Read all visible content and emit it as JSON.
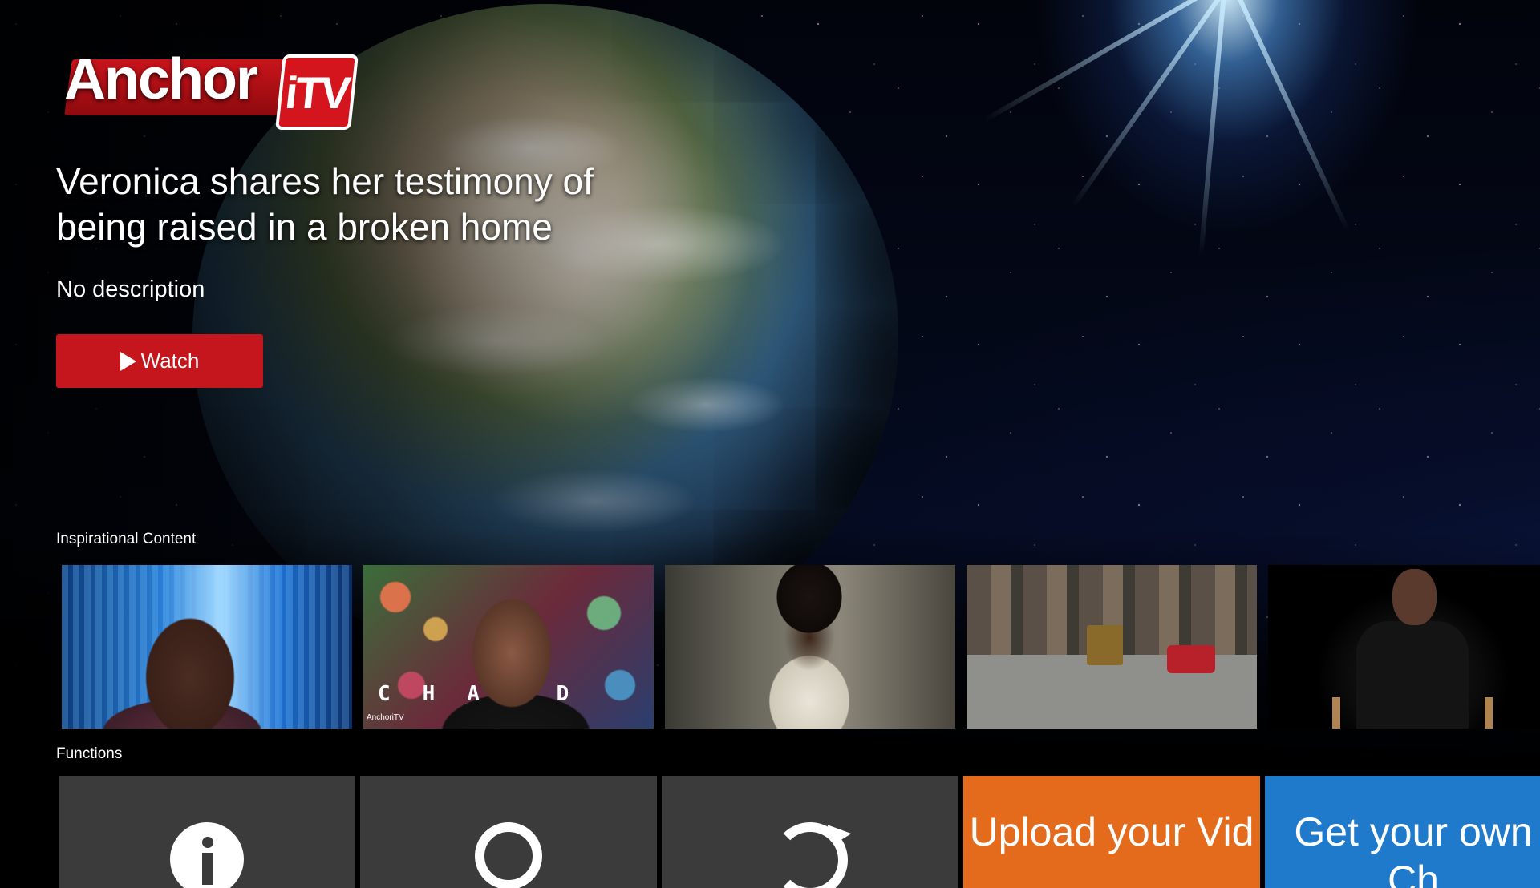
{
  "brand": {
    "word": "Anchor",
    "badge": "iTV"
  },
  "hero": {
    "title": "Veronica shares her testimony of being raised in a broken home",
    "description": "No description",
    "watch_label": "Watch"
  },
  "rows": {
    "inspirational": {
      "title": "Inspirational Content",
      "thumb2_overlay": "CHA D",
      "thumb2_logo": "AnchoriTV"
    },
    "functions": {
      "title": "Functions",
      "tiles": [
        {
          "icon": "info-icon"
        },
        {
          "icon": "search-icon"
        },
        {
          "icon": "refresh-icon"
        },
        {
          "text": "Upload your Vid"
        },
        {
          "text": "Get your own Ch"
        }
      ]
    }
  },
  "colors": {
    "accent_red": "#c4161c",
    "upload_orange": "#e46b1c",
    "channel_blue": "#1f7acb",
    "tile_gray": "#3b3b3b"
  }
}
